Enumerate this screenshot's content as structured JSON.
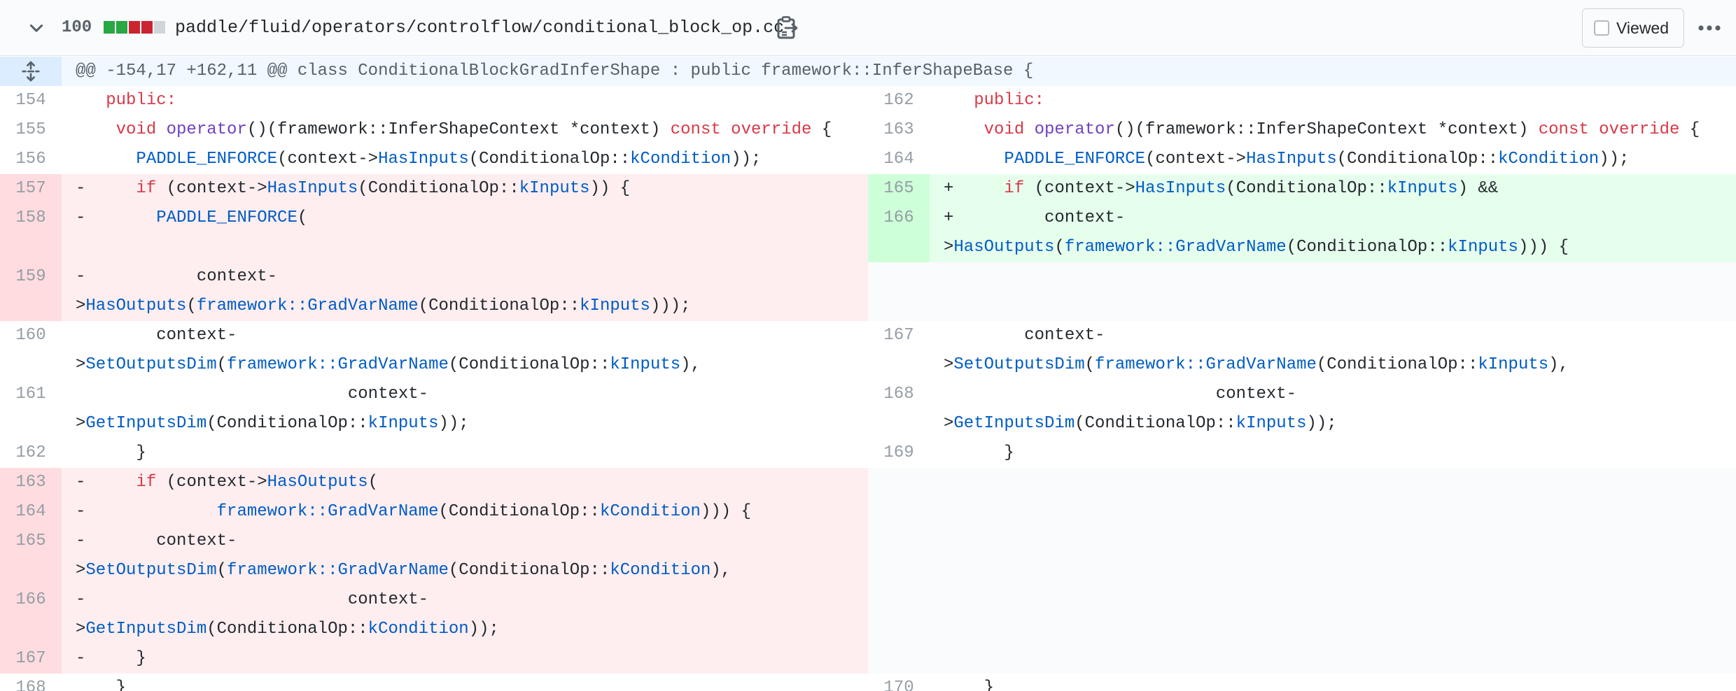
{
  "file": {
    "lines_changed": "100",
    "diffstat": [
      "#28a745",
      "#28a745",
      "#cb2431",
      "#cb2431",
      "#d1d5da"
    ],
    "path": "paddle/fluid/operators/controlflow/conditional_block_op.cc",
    "viewed_label": "Viewed",
    "icons": [
      "chevron-down-icon",
      "clipboard-icon",
      "kebab-horizontal-icon",
      "unfold-icon"
    ]
  },
  "hunk": {
    "header": "@@ -154,17 +162,11 @@ class ConditionalBlockGradInferShape : public framework::InferShapeBase {"
  },
  "colors": {
    "keyword": "#d73a49",
    "entity": "#005cc5",
    "function": "#6f42c1",
    "deletion_bg": "#ffeef0",
    "addition_bg": "#e6ffed"
  },
  "rows": [
    {
      "left": {
        "type": "ctx",
        "num": "154",
        "tokens": [
          [
            "   ",
            ""
          ],
          [
            "public",
            "r"
          ],
          [
            ":",
            "r"
          ]
        ]
      },
      "right": {
        "type": "ctx",
        "num": "162",
        "tokens": [
          [
            "   ",
            ""
          ],
          [
            "public",
            "r"
          ],
          [
            ":",
            "r"
          ]
        ]
      }
    },
    {
      "left": {
        "type": "ctx",
        "num": "155",
        "tokens": [
          [
            "    ",
            ""
          ],
          [
            "void",
            "r"
          ],
          [
            " ",
            ""
          ],
          [
            "operator",
            "p"
          ],
          [
            "()(framework::InferShapeContext *context) ",
            ""
          ],
          [
            "const",
            "r"
          ],
          [
            " ",
            ""
          ],
          [
            "override",
            "r"
          ],
          [
            " {",
            ""
          ]
        ]
      },
      "right": {
        "type": "ctx",
        "num": "163",
        "tokens": [
          [
            "    ",
            ""
          ],
          [
            "void",
            "r"
          ],
          [
            " ",
            ""
          ],
          [
            "operator",
            "p"
          ],
          [
            "()(framework::InferShapeContext *context) ",
            ""
          ],
          [
            "const",
            "r"
          ],
          [
            " ",
            ""
          ],
          [
            "override",
            "r"
          ],
          [
            " {",
            ""
          ]
        ]
      }
    },
    {
      "left": {
        "type": "ctx",
        "num": "156",
        "tokens": [
          [
            "      ",
            ""
          ],
          [
            "PADDLE_ENFORCE",
            "b"
          ],
          [
            "(context->",
            ""
          ],
          [
            "HasInputs",
            "b"
          ],
          [
            "(ConditionalOp::",
            ""
          ],
          [
            "kCondition",
            "b"
          ],
          [
            "));",
            ""
          ]
        ]
      },
      "right": {
        "type": "ctx",
        "num": "164",
        "tokens": [
          [
            "      ",
            ""
          ],
          [
            "PADDLE_ENFORCE",
            "b"
          ],
          [
            "(context->",
            ""
          ],
          [
            "HasInputs",
            "b"
          ],
          [
            "(ConditionalOp::",
            ""
          ],
          [
            "kCondition",
            "b"
          ],
          [
            "));",
            ""
          ]
        ]
      }
    },
    {
      "left": {
        "type": "del",
        "num": "157",
        "tokens": [
          [
            "-     ",
            ""
          ],
          [
            "if",
            "r"
          ],
          [
            " (context->",
            ""
          ],
          [
            "HasInputs",
            "b"
          ],
          [
            "(ConditionalOp::",
            ""
          ],
          [
            "kInputs",
            "b"
          ],
          [
            ")) {",
            ""
          ]
        ]
      },
      "right": {
        "type": "add",
        "num": "165",
        "tokens": [
          [
            "+     ",
            ""
          ],
          [
            "if",
            "r"
          ],
          [
            " (context->",
            ""
          ],
          [
            "HasInputs",
            "b"
          ],
          [
            "(ConditionalOp::",
            ""
          ],
          [
            "kInputs",
            "b"
          ],
          [
            ") &&",
            ""
          ]
        ]
      }
    },
    {
      "left": {
        "type": "del",
        "num": "158",
        "tokens": [
          [
            "-       ",
            ""
          ],
          [
            "PADDLE_ENFORCE",
            "b"
          ],
          [
            "(",
            ""
          ],
          [
            "\n",
            ""
          ]
        ]
      },
      "right": {
        "type": "add",
        "num": "166",
        "tokens": [
          [
            "+         context-",
            ""
          ],
          [
            "\n>",
            ""
          ],
          [
            "HasOutputs",
            "b"
          ],
          [
            "(",
            ""
          ],
          [
            "framework::GradVarName",
            "b"
          ],
          [
            "(ConditionalOp::",
            ""
          ],
          [
            "kInputs",
            "b"
          ],
          [
            "))) {",
            ""
          ]
        ]
      }
    },
    {
      "left": {
        "type": "del",
        "num": "159",
        "tokens": [
          [
            "-           context-",
            ""
          ],
          [
            "\n>",
            ""
          ],
          [
            "HasOutputs",
            "b"
          ],
          [
            "(",
            ""
          ],
          [
            "framework::GradVarName",
            "b"
          ],
          [
            "(ConditionalOp::",
            ""
          ],
          [
            "kInputs",
            "b"
          ],
          [
            ")));",
            ""
          ]
        ]
      },
      "right": {
        "type": "empty",
        "num": "",
        "tokens": [
          [
            " \n ",
            ""
          ]
        ]
      }
    },
    {
      "left": {
        "type": "ctx",
        "num": "160",
        "tokens": [
          [
            "        context-",
            ""
          ],
          [
            "\n>",
            ""
          ],
          [
            "SetOutputsDim",
            "b"
          ],
          [
            "(",
            ""
          ],
          [
            "framework::GradVarName",
            "b"
          ],
          [
            "(ConditionalOp::",
            ""
          ],
          [
            "kInputs",
            "b"
          ],
          [
            "),",
            ""
          ]
        ]
      },
      "right": {
        "type": "ctx",
        "num": "167",
        "tokens": [
          [
            "        context-",
            ""
          ],
          [
            "\n>",
            ""
          ],
          [
            "SetOutputsDim",
            "b"
          ],
          [
            "(",
            ""
          ],
          [
            "framework::GradVarName",
            "b"
          ],
          [
            "(ConditionalOp::",
            ""
          ],
          [
            "kInputs",
            "b"
          ],
          [
            "),",
            ""
          ]
        ]
      }
    },
    {
      "left": {
        "type": "ctx",
        "num": "161",
        "tokens": [
          [
            "                           context-",
            ""
          ],
          [
            "\n>",
            ""
          ],
          [
            "GetInputsDim",
            "b"
          ],
          [
            "(ConditionalOp::",
            ""
          ],
          [
            "kInputs",
            "b"
          ],
          [
            "));",
            ""
          ]
        ]
      },
      "right": {
        "type": "ctx",
        "num": "168",
        "tokens": [
          [
            "                           context-",
            ""
          ],
          [
            "\n>",
            ""
          ],
          [
            "GetInputsDim",
            "b"
          ],
          [
            "(ConditionalOp::",
            ""
          ],
          [
            "kInputs",
            "b"
          ],
          [
            "));",
            ""
          ]
        ]
      }
    },
    {
      "left": {
        "type": "ctx",
        "num": "162",
        "tokens": [
          [
            "      }",
            ""
          ]
        ]
      },
      "right": {
        "type": "ctx",
        "num": "169",
        "tokens": [
          [
            "      }",
            ""
          ]
        ]
      }
    },
    {
      "left": {
        "type": "del",
        "num": "163",
        "tokens": [
          [
            "-     ",
            ""
          ],
          [
            "if",
            "r"
          ],
          [
            " (context->",
            ""
          ],
          [
            "HasOutputs",
            "b"
          ],
          [
            "(",
            ""
          ]
        ]
      },
      "right": {
        "type": "empty",
        "num": "",
        "tokens": [
          [
            " ",
            ""
          ]
        ]
      }
    },
    {
      "left": {
        "type": "del",
        "num": "164",
        "tokens": [
          [
            "-             ",
            ""
          ],
          [
            "framework::GradVarName",
            "b"
          ],
          [
            "(ConditionalOp::",
            ""
          ],
          [
            "kCondition",
            "b"
          ],
          [
            "))) {",
            ""
          ]
        ]
      },
      "right": {
        "type": "empty",
        "num": "",
        "tokens": [
          [
            " ",
            ""
          ]
        ]
      }
    },
    {
      "left": {
        "type": "del",
        "num": "165",
        "tokens": [
          [
            "-       context-",
            ""
          ],
          [
            "\n>",
            ""
          ],
          [
            "SetOutputsDim",
            "b"
          ],
          [
            "(",
            ""
          ],
          [
            "framework::GradVarName",
            "b"
          ],
          [
            "(ConditionalOp::",
            ""
          ],
          [
            "kCondition",
            "b"
          ],
          [
            "),",
            ""
          ]
        ]
      },
      "right": {
        "type": "empty",
        "num": "",
        "tokens": [
          [
            " \n ",
            ""
          ]
        ]
      }
    },
    {
      "left": {
        "type": "del",
        "num": "166",
        "tokens": [
          [
            "-                          context-",
            ""
          ],
          [
            "\n>",
            ""
          ],
          [
            "GetInputsDim",
            "b"
          ],
          [
            "(ConditionalOp::",
            ""
          ],
          [
            "kCondition",
            "b"
          ],
          [
            "));",
            ""
          ]
        ]
      },
      "right": {
        "type": "empty",
        "num": "",
        "tokens": [
          [
            " \n ",
            ""
          ]
        ]
      }
    },
    {
      "left": {
        "type": "del",
        "num": "167",
        "tokens": [
          [
            "-     }",
            ""
          ]
        ]
      },
      "right": {
        "type": "empty",
        "num": "",
        "tokens": [
          [
            " ",
            ""
          ]
        ]
      }
    },
    {
      "left": {
        "type": "ctx",
        "num": "168",
        "tokens": [
          [
            "    }",
            ""
          ]
        ]
      },
      "right": {
        "type": "ctx",
        "num": "170",
        "tokens": [
          [
            "    }",
            ""
          ]
        ]
      }
    }
  ]
}
